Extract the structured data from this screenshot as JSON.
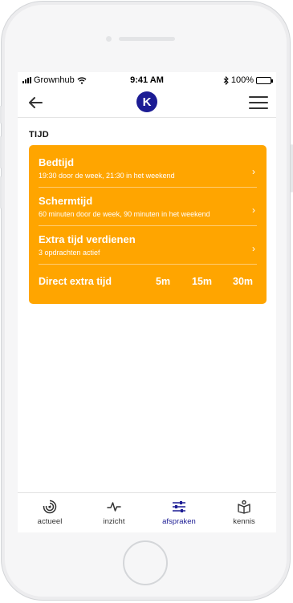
{
  "status_bar": {
    "carrier": "Grownhub",
    "time": "9:41 AM",
    "battery": "100%"
  },
  "nav": {
    "logo_letter": "K",
    "brand_color": "#1c1c94"
  },
  "section": {
    "title": "TIJD"
  },
  "card": {
    "accent_color": "#ffa500",
    "rows": [
      {
        "title": "Bedtijd",
        "subtitle": "19:30 door de week, 21:30 in het weekend"
      },
      {
        "title": "Schermtijd",
        "subtitle": "60 minuten door de week, 90 minuten in het weekend"
      },
      {
        "title": "Extra tijd verdienen",
        "subtitle": "3 opdrachten actief"
      }
    ],
    "chevron": "›",
    "quick": {
      "label": "Direct extra tijd",
      "options": [
        "5m",
        "15m",
        "30m"
      ]
    }
  },
  "tabbar": {
    "tabs": [
      {
        "label": "actueel",
        "icon": "radar-icon",
        "active": false
      },
      {
        "label": "inzicht",
        "icon": "pulse-icon",
        "active": false
      },
      {
        "label": "afspraken",
        "icon": "sliders-icon",
        "active": true
      },
      {
        "label": "kennis",
        "icon": "book-icon",
        "active": false
      }
    ]
  }
}
